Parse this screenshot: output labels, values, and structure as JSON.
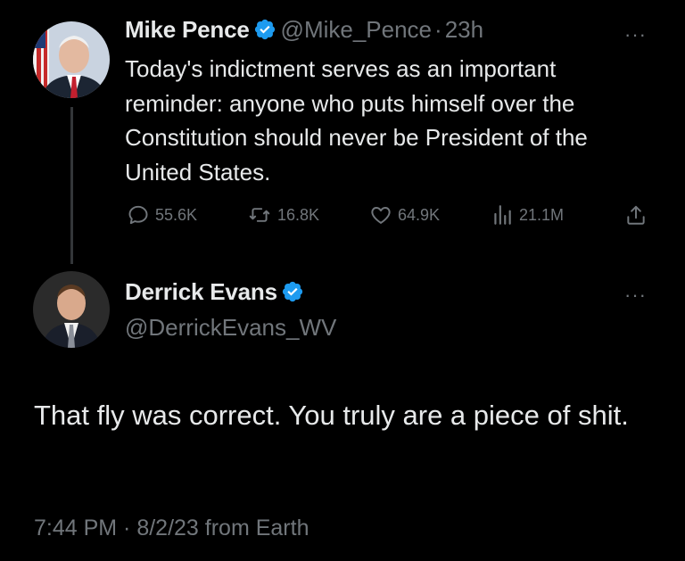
{
  "tweet": {
    "author_name": "Mike Pence",
    "handle": "@Mike_Pence",
    "separator": "·",
    "time": "23h",
    "more_label": "···",
    "text": "Today's indictment serves as an important reminder: anyone who puts himself over the Constitution should never be President of the United States.",
    "stats": {
      "replies": "55.6K",
      "retweets": "16.8K",
      "likes": "64.9K",
      "views": "21.1M"
    }
  },
  "reply": {
    "author_name": "Derrick Evans",
    "handle": "@DerrickEvans_WV",
    "more_label": "···",
    "text": "That fly was correct. You truly are a piece of shit.",
    "timestamp": "7:44 PM · 8/2/23 from Earth"
  },
  "colors": {
    "background": "#000000",
    "text": "#e7e9ea",
    "muted": "#71767b",
    "verified_blue": "#1d9bf0"
  },
  "icons": {
    "reply": "comment-bubble-icon",
    "retweet": "retweet-icon",
    "like": "heart-icon",
    "views": "bar-chart-icon",
    "share": "share-icon",
    "verified": "verified-badge-icon"
  }
}
